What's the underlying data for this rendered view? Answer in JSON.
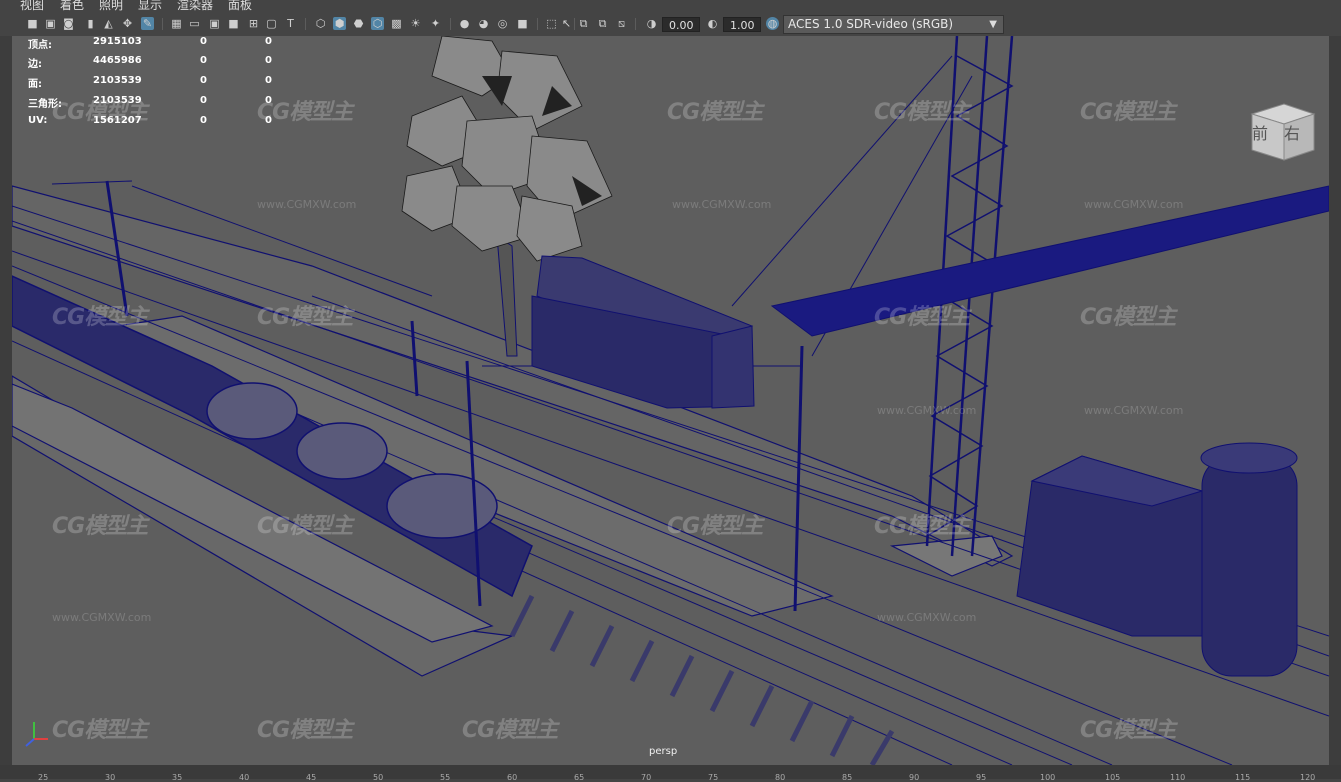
{
  "menu": {
    "items": [
      "视图",
      "着色",
      "照明",
      "显示",
      "渲染器",
      "面板"
    ]
  },
  "toolbar": {
    "field1_value": "0.00",
    "field2_value": "1.00",
    "colorspace": "ACES 1.0 SDR-video (sRGB)"
  },
  "hud": {
    "rows": [
      {
        "label": "顶点:",
        "total": "2915103",
        "sel": "0",
        "comp": "0"
      },
      {
        "label": "边:",
        "total": "4465986",
        "sel": "0",
        "comp": "0"
      },
      {
        "label": "面:",
        "total": "2103539",
        "sel": "0",
        "comp": "0"
      },
      {
        "label": "三角形:",
        "total": "2103539",
        "sel": "0",
        "comp": "0"
      },
      {
        "label": "UV:",
        "total": "1561207",
        "sel": "0",
        "comp": "0"
      }
    ]
  },
  "viewport": {
    "camera": "persp",
    "viewcube": {
      "front": "前",
      "right": "右"
    }
  },
  "watermark": {
    "logo": "CG模型主",
    "url": "www.CGMXW.com"
  },
  "ruler": {
    "ticks": [
      "25",
      "30",
      "35",
      "40",
      "45",
      "50",
      "55",
      "60",
      "65",
      "70",
      "75",
      "80",
      "85",
      "90",
      "95",
      "100",
      "105",
      "110",
      "115",
      "120"
    ]
  },
  "colors": {
    "wire": "#101070",
    "background": "#5e5e5e",
    "accent": "#5285a6"
  }
}
